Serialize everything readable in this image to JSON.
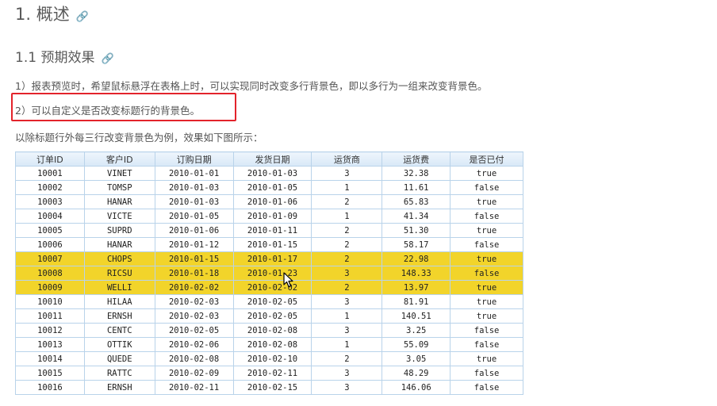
{
  "heading1": "1. 概述",
  "heading2": "1.1 预期效果",
  "paragraph1": "1）报表预览时，希望鼠标悬浮在表格上时，可以实现同时改变多行背景色，即以多行为一组来改变背景色。",
  "paragraph2": "2）可以自定义是否改变标题行的背景色。",
  "paragraph3": "以除标题行外每三行改变背景色为例，效果如下图所示：",
  "anchor_icon": "link-icon",
  "table": {
    "columns": [
      "订单ID",
      "客户ID",
      "订购日期",
      "发货日期",
      "运货商",
      "运货费",
      "是否已付"
    ],
    "highlight_color": "#f2d42a",
    "highlighted_rows": [
      6,
      7,
      8
    ],
    "rows": [
      [
        "10001",
        "VINET",
        "2010-01-01",
        "2010-01-03",
        "3",
        "32.38",
        "true"
      ],
      [
        "10002",
        "TOMSP",
        "2010-01-03",
        "2010-01-05",
        "1",
        "11.61",
        "false"
      ],
      [
        "10003",
        "HANAR",
        "2010-01-03",
        "2010-01-06",
        "2",
        "65.83",
        "true"
      ],
      [
        "10004",
        "VICTE",
        "2010-01-05",
        "2010-01-09",
        "1",
        "41.34",
        "false"
      ],
      [
        "10005",
        "SUPRD",
        "2010-01-06",
        "2010-01-11",
        "2",
        "51.30",
        "true"
      ],
      [
        "10006",
        "HANAR",
        "2010-01-12",
        "2010-01-15",
        "2",
        "58.17",
        "false"
      ],
      [
        "10007",
        "CHOPS",
        "2010-01-15",
        "2010-01-17",
        "2",
        "22.98",
        "true"
      ],
      [
        "10008",
        "RICSU",
        "2010-01-18",
        "2010-01-23",
        "3",
        "148.33",
        "false"
      ],
      [
        "10009",
        "WELLI",
        "2010-02-02",
        "2010-02-02",
        "2",
        "13.97",
        "true"
      ],
      [
        "10010",
        "HILAA",
        "2010-02-03",
        "2010-02-05",
        "3",
        "81.91",
        "true"
      ],
      [
        "10011",
        "ERNSH",
        "2010-02-03",
        "2010-02-05",
        "1",
        "140.51",
        "true"
      ],
      [
        "10012",
        "CENTC",
        "2010-02-05",
        "2010-02-08",
        "3",
        "3.25",
        "false"
      ],
      [
        "10013",
        "OTTIK",
        "2010-02-06",
        "2010-02-08",
        "1",
        "55.09",
        "false"
      ],
      [
        "10014",
        "QUEDE",
        "2010-02-08",
        "2010-02-10",
        "2",
        "3.05",
        "true"
      ],
      [
        "10015",
        "RATTC",
        "2010-02-09",
        "2010-02-11",
        "3",
        "48.29",
        "false"
      ],
      [
        "10016",
        "ERNSH",
        "2010-02-11",
        "2010-02-15",
        "3",
        "146.06",
        "false"
      ]
    ]
  }
}
